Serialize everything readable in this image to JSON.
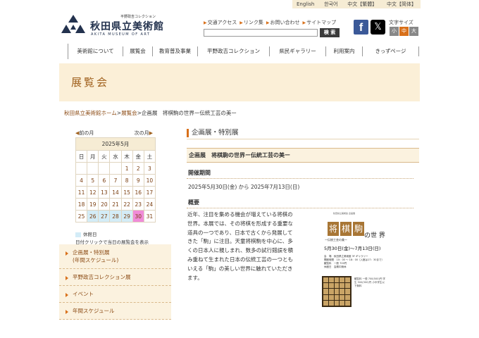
{
  "lang": [
    "English",
    "한국어",
    "中文【繁體】",
    "中文【简体】"
  ],
  "logo": {
    "small": "平野政吉コレクション",
    "name": "秋田県立美術館",
    "en": "AKITA MUSEUM OF ART"
  },
  "util_links": [
    "交通アクセス",
    "リンク集",
    "お問い合わせ",
    "サイトマップ"
  ],
  "search": {
    "button": "検 索",
    "placeholder": ""
  },
  "social": {
    "facebook": "f",
    "x": "𝕏"
  },
  "fontsize": {
    "label": "文字サイズ",
    "buttons": [
      "小",
      "中",
      "大"
    ],
    "colors": [
      "#888888",
      "#d8701a",
      "#888888"
    ]
  },
  "nav": [
    "美術館について",
    "展覧会",
    "教育普及事業",
    "平野政吉コレクション",
    "県民ギャラリー",
    "利用案内",
    "きっずページ"
  ],
  "banner": {
    "title": "展覧会"
  },
  "breadcrumb": {
    "home": "秋田県立美術館ホーム",
    "sep1": ">",
    "section": "展覧会",
    "sep2": ">",
    "current": "企画展　将棋駒の世界ー伝統工芸の美ー"
  },
  "calendar": {
    "prev": "前の月",
    "next": "次の月",
    "month": "2025年5月",
    "weekdays": [
      "日",
      "月",
      "火",
      "水",
      "木",
      "金",
      "土"
    ],
    "weeks": [
      [
        "",
        "",
        "",
        "",
        "1",
        "2",
        "3"
      ],
      [
        "4",
        "5",
        "6",
        "7",
        "8",
        "9",
        "10"
      ],
      [
        "11",
        "12",
        "13",
        "14",
        "15",
        "16",
        "17"
      ],
      [
        "18",
        "19",
        "20",
        "21",
        "22",
        "23",
        "24"
      ],
      [
        "25",
        "26",
        "27",
        "28",
        "29",
        "30",
        "31"
      ]
    ],
    "closed_days": [
      "26",
      "27",
      "28",
      "29"
    ],
    "today": "30",
    "legend": "休館日",
    "caption": "日付クリックで当日の展覧会を表示"
  },
  "side_menu": [
    {
      "lines": [
        "企画展・特別展",
        "(年間スケジュール)"
      ]
    },
    {
      "lines": [
        "平野政吉コレクション展"
      ]
    },
    {
      "lines": [
        "イベント"
      ]
    },
    {
      "lines": [
        "年間スケジュール"
      ]
    }
  ],
  "content": {
    "section_title": "企画展・特別展",
    "exhibit_title": "企画展　将棋駒の世界ー伝統工芸の美ー",
    "period_heading": "開催期間",
    "period": "2025年5月30日(金) から 2025年7月13日(日)",
    "overview_heading": "概要",
    "overview": "近年、注目を集める機会が増えている将棋の世界。本展では、その将棋を形成する重要な道具の一つであり、日本で古くから発展してきた「駒」に注目。天童将棋駒を中心に、多くの日本人に親しまれ、数多の試行錯誤を積み重ねて生まれた日本の伝統工芸の一つともいえる「駒」の美しい世界に触れていただきます。"
  },
  "poster": {
    "top": "秋田県立美術館 企画展",
    "chars": [
      "将",
      "棋",
      "駒"
    ],
    "no": "の",
    "sekai": "世 界",
    "sub": "ー伝統工芸の美ー",
    "date": "5月30日(金)～7月13日(日)",
    "info": [
      "会　場　秋田県立美術館 3F ギャラリー",
      "開館時間　10：00 ～ 18：00（入館は17：30まで）",
      "観覧料　一般 700円",
      "休館日　会期中無休"
    ],
    "text": "観覧料 一般 700(500)円 学生 500(300)円 小中学生以下無料"
  }
}
